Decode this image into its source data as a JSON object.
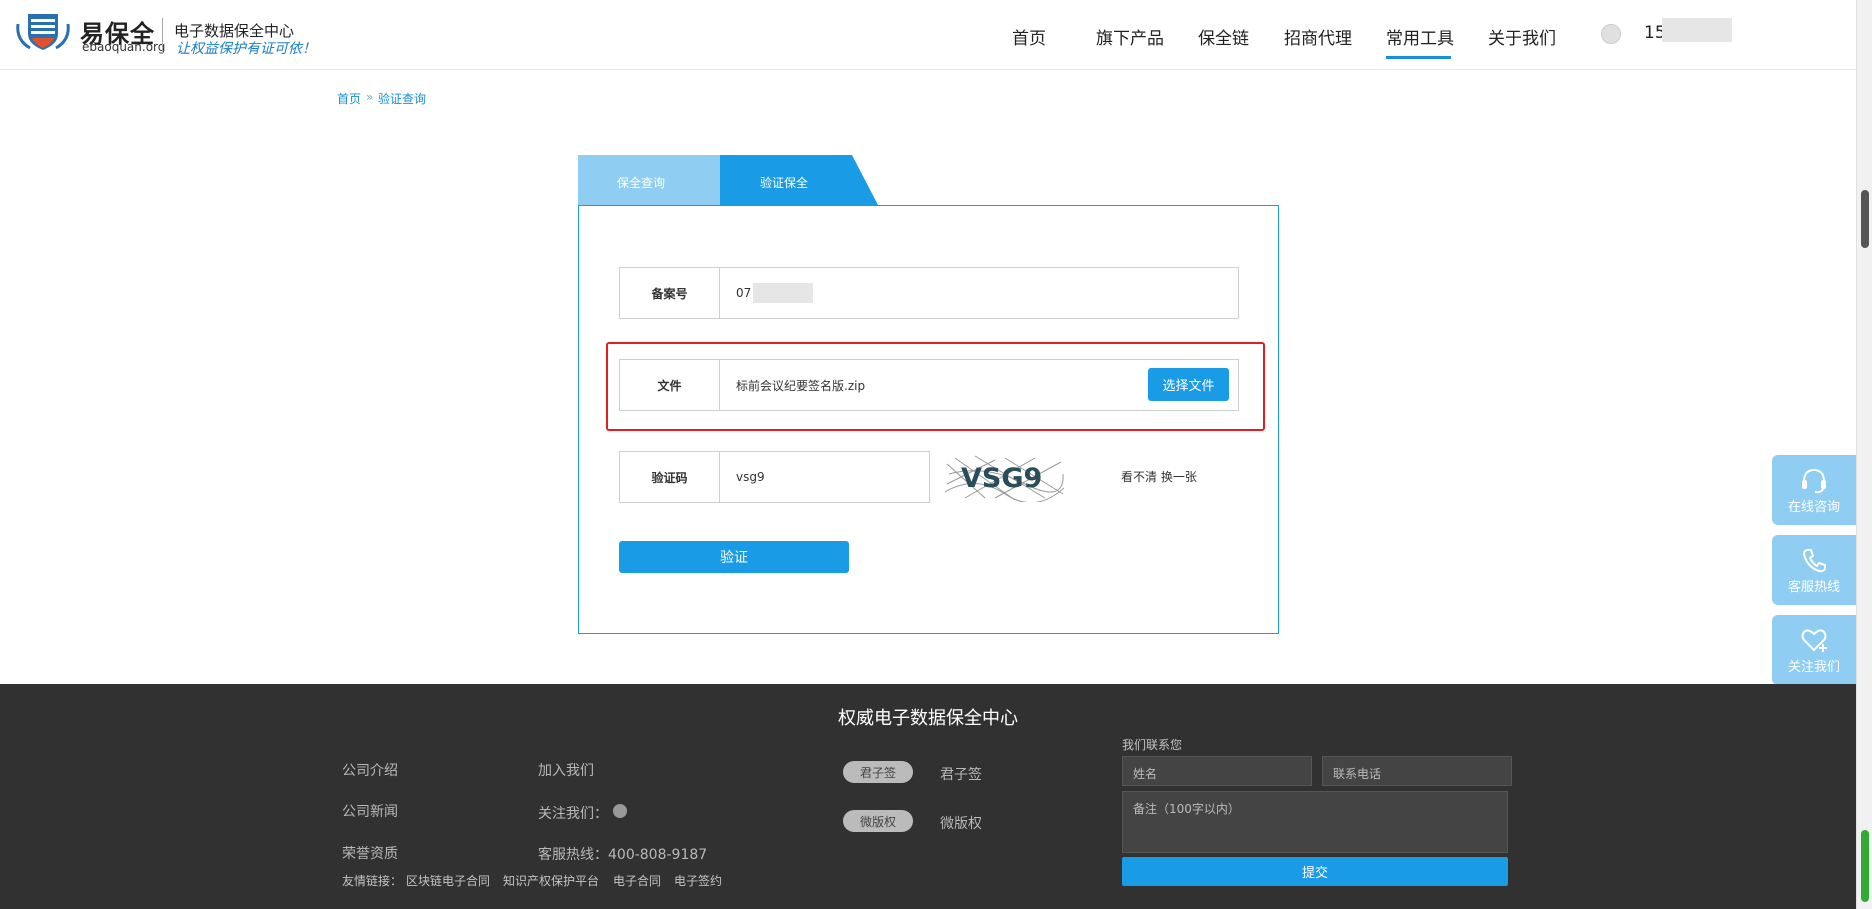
{
  "header": {
    "logo": {
      "brand": "易保全",
      "domain": "ebaoquan.org",
      "tagline1": "电子数据保全中心",
      "tagline2": "让权益保护有证可依！"
    },
    "nav": [
      "首页",
      "旗下产品",
      "保全链",
      "招商代理",
      "常用工具",
      "关于我们"
    ],
    "active_nav": "常用工具",
    "user": "15"
  },
  "breadcrumb": {
    "home": "首页",
    "sep": "»",
    "current": "验证查询"
  },
  "tabs": [
    {
      "label": "保全查询",
      "active": false
    },
    {
      "label": "验证保全",
      "active": true
    }
  ],
  "form": {
    "record_label": "备案号",
    "record_value": "07",
    "file_label": "文件",
    "file_value": "标前会议纪要签名版.zip",
    "choose_file": "选择文件",
    "captcha_label": "验证码",
    "captcha_value": "vsg9",
    "captcha_image_text": "VSG9",
    "refresh_text": "看不清 换一张",
    "verify_button": "验证"
  },
  "side_buttons": [
    "在线咨询",
    "客服热线",
    "关注我们"
  ],
  "footer": {
    "title": "权威电子数据保全中心",
    "links_col1": [
      "公司介绍",
      "公司新闻",
      "荣誉资质"
    ],
    "links_col2": [
      "加入我们",
      "关注我们："
    ],
    "hotline": "客服热线：400-808-9187",
    "friend_links_label": "友情链接：",
    "friend_links": [
      "区块链电子合同",
      "知识产权保护平台",
      "电子合同",
      "电子签约"
    ],
    "partners": [
      {
        "badge": "君子签",
        "name": "君子签"
      },
      {
        "badge": "微版权",
        "name": "微版权"
      }
    ],
    "contact": {
      "title": "我们联系您",
      "name_placeholder": "姓名",
      "phone_placeholder": "联系电话",
      "note_placeholder": "备注（100字以内）",
      "submit": "提交"
    }
  },
  "colors": {
    "accent": "#1a9be6",
    "tab_inactive": "#8fcdf2",
    "highlight": "#e02020",
    "footer_bg": "#313131"
  }
}
